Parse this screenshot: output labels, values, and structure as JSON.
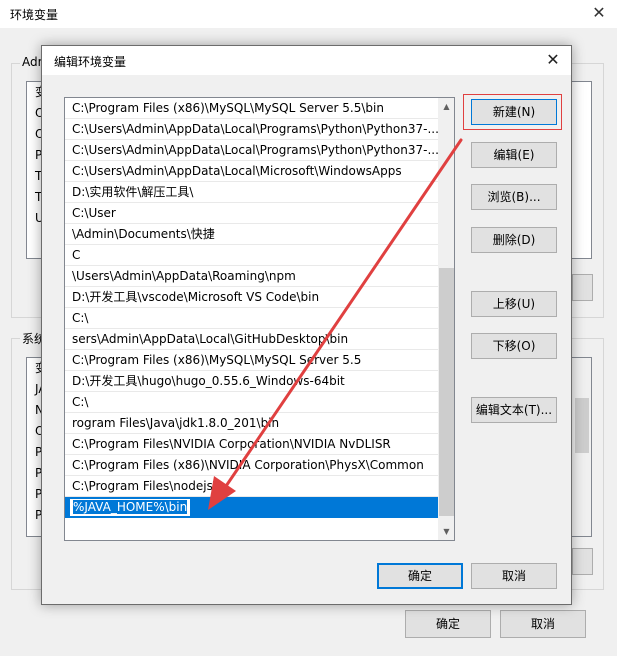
{
  "background_window": {
    "title": "环境变量",
    "user_group_label": "Adm",
    "user_rows": [
      "变",
      "O",
      "O",
      "Pa",
      "TE",
      "TN",
      "UI"
    ],
    "system_group_label": "系统",
    "system_rows": [
      "变",
      "JA",
      "N",
      "O",
      "Pa",
      "PA",
      "PF",
      "PF"
    ],
    "ok_label": "确定",
    "cancel_label": "取消"
  },
  "dialog": {
    "title": "编辑环境变量",
    "paths": [
      "C:\\Program Files (x86)\\MySQL\\MySQL Server 5.5\\bin",
      "C:\\Users\\Admin\\AppData\\Local\\Programs\\Python\\Python37-...",
      "C:\\Users\\Admin\\AppData\\Local\\Programs\\Python\\Python37-...",
      "C:\\Users\\Admin\\AppData\\Local\\Microsoft\\WindowsApps",
      "D:\\实用软件\\解压工具\\",
      "C:\\User",
      "\\Admin\\Documents\\快捷",
      "C",
      "\\Users\\Admin\\AppData\\Roaming\\npm",
      "D:\\开发工具\\vscode\\Microsoft VS Code\\bin",
      "C:\\",
      "sers\\Admin\\AppData\\Local\\GitHubDesktop\\bin",
      "C:\\Program Files (x86)\\MySQL\\MySQL Server 5.5",
      "D:\\开发工具\\hugo\\hugo_0.55.6_Windows-64bit",
      "C:\\",
      "rogram Files\\Java\\jdk1.8.0_201\\bin",
      "C:\\Program Files\\NVIDIA Corporation\\NVIDIA NvDLISR",
      "C:\\Program Files (x86)\\NVIDIA Corporation\\PhysX\\Common",
      "C:\\Program Files\\nodejs\\"
    ],
    "editing_value": "%JAVA_HOME%\\bin",
    "buttons": {
      "new": "新建(N)",
      "edit": "编辑(E)",
      "browse": "浏览(B)...",
      "delete": "删除(D)",
      "move_up": "上移(U)",
      "move_down": "下移(O)",
      "edit_text": "编辑文本(T)..."
    },
    "ok_label": "确定",
    "cancel_label": "取消"
  },
  "colors": {
    "selection": "#0078d7",
    "annotation": "#e04040"
  }
}
